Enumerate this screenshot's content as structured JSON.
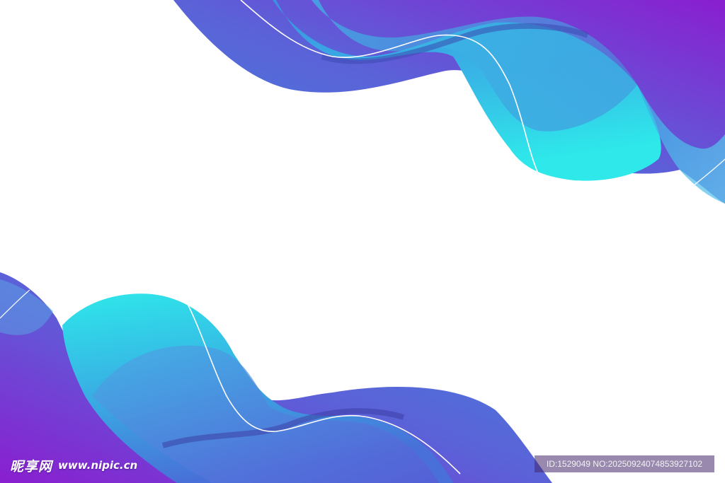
{
  "watermark": {
    "site_name_cn": "昵享网",
    "site_url": "www.nipic.cn",
    "image_id": "ID:1529049 NO:20250924074853927102"
  },
  "colors": {
    "cyan": "#2ee6ea",
    "sky_blue": "#3aa0e0",
    "royal_blue": "#4a6ad8",
    "violet": "#8a1ed0",
    "background": "#ffffff"
  }
}
